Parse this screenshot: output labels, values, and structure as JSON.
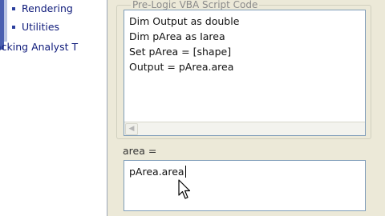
{
  "tree": {
    "items": [
      {
        "label": "Rendering"
      },
      {
        "label": "Utilities"
      },
      {
        "label": "acking Analyst T"
      }
    ]
  },
  "script_group": {
    "title": "Pre-Logic VBA Script Code",
    "lines": [
      "Dim Output as double",
      "Dim pArea as Iarea",
      "Set pArea = [shape]",
      "Output = pArea.area"
    ]
  },
  "result": {
    "label": "area =",
    "value": "pArea.area"
  },
  "icons": {
    "scroll_left": "scroll-left-arrow-icon",
    "pointer": "mouse-pointer-icon"
  }
}
